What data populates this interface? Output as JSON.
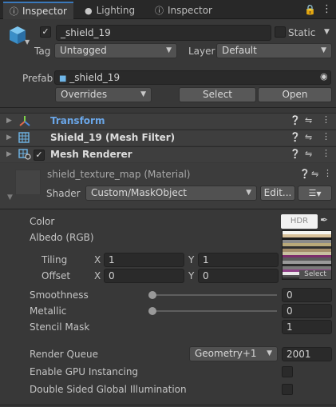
{
  "tabs": [
    {
      "label": "Inspector",
      "icon": "info-icon",
      "active": true
    },
    {
      "label": "Lighting",
      "icon": "lightbulb-icon",
      "active": false
    },
    {
      "label": "Inspector",
      "icon": "info-icon",
      "active": false
    }
  ],
  "header": {
    "object_name": "_shield_19",
    "static_label": "Static",
    "tag_label": "Tag",
    "tag_value": "Untagged",
    "layer_label": "Layer",
    "layer_value": "Default",
    "prefab_label": "Prefab",
    "prefab_value": "_shield_19",
    "overrides_label": "Overrides",
    "select_label": "Select",
    "open_label": "Open"
  },
  "components": [
    {
      "name": "Transform",
      "icon": "transform-axes-icon"
    },
    {
      "name": "Shield_19 (Mesh Filter)",
      "icon": "mesh-grid-icon"
    },
    {
      "name": "Mesh Renderer",
      "icon": "mesh-renderer-icon"
    }
  ],
  "material": {
    "name": "shield_texture_map (Material)",
    "shader_label": "Shader",
    "shader_value": "Custom/MaskObject",
    "edit_label": "Edit..."
  },
  "properties": {
    "color_label": "Color",
    "hdr_label": "HDR",
    "albedo_label": "Albedo (RGB)",
    "tiling_label": "Tiling",
    "tiling_x": "1",
    "tiling_y": "1",
    "offset_label": "Offset",
    "offset_x": "0",
    "offset_y": "0",
    "x_label": "X",
    "y_label": "Y",
    "select_texture_label": "Select",
    "smoothness_label": "Smoothness",
    "smoothness_value": "0",
    "metallic_label": "Metallic",
    "metallic_value": "0",
    "stencil_label": "Stencil Mask",
    "stencil_value": "1",
    "render_queue_label": "Render Queue",
    "render_queue_mode": "Geometry+1",
    "render_queue_value": "2001",
    "gpu_instancing_label": "Enable GPU Instancing",
    "double_sided_label": "Double Sided Global Illumination"
  },
  "colors": {
    "accent": "#3a79bb",
    "panel": "#383838",
    "transform_title": "#6aa6e8"
  }
}
